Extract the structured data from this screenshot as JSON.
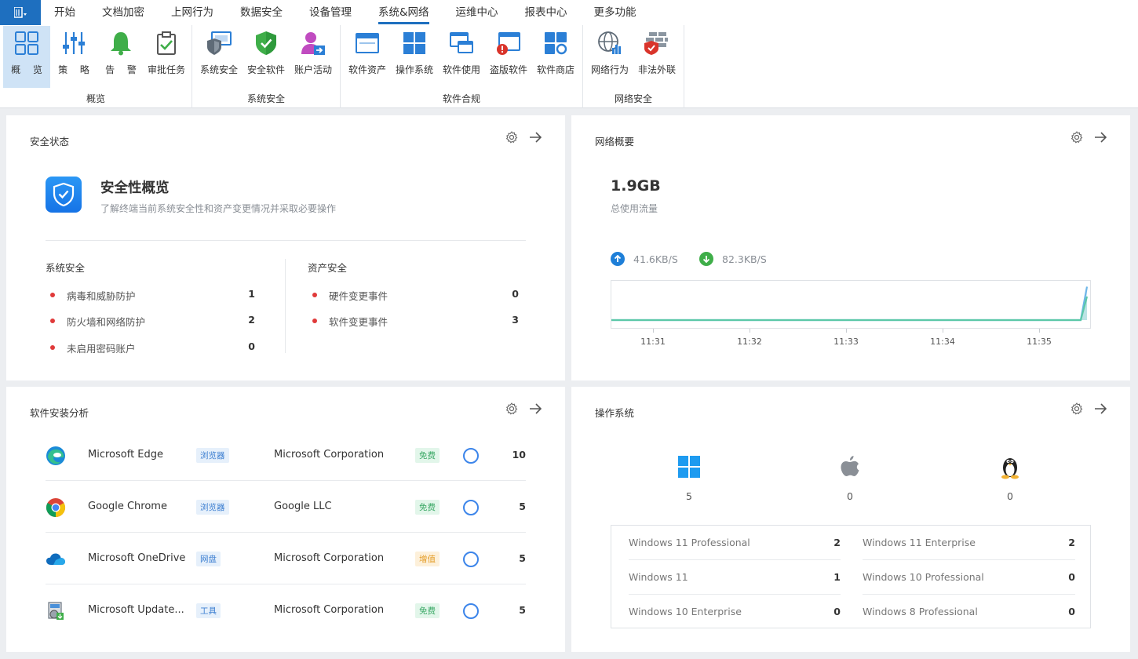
{
  "menu": {
    "tabs": [
      {
        "label": "开始"
      },
      {
        "label": "文档加密"
      },
      {
        "label": "上网行为"
      },
      {
        "label": "数据安全"
      },
      {
        "label": "设备管理"
      },
      {
        "label": "系统&网络",
        "active": true
      },
      {
        "label": "运维中心"
      },
      {
        "label": "报表中心"
      },
      {
        "label": "更多功能"
      }
    ]
  },
  "ribbon": {
    "groups": {
      "overview": "概览",
      "system_security": "系统安全",
      "software_compliance": "软件合规",
      "network_security": "网络安全"
    },
    "buttons": {
      "overview": "概 览",
      "policy": "策 略",
      "alert": "告 警",
      "approval": "审批任务",
      "sys_security": "系统安全",
      "security_software": "安全软件",
      "account_activity": "账户活动",
      "software_assets": "软件资产",
      "operating_system": "操作系统",
      "software_usage": "软件使用",
      "pirated_software": "盗版软件",
      "software_store": "软件商店",
      "network_behavior": "网络行为",
      "illegal_outreach": "非法外联"
    }
  },
  "security_card": {
    "title": "安全状态",
    "heading": "安全性概览",
    "subtitle": "了解终端当前系统安全性和资产变更情况并采取必要操作",
    "system": {
      "title": "系统安全",
      "items": [
        {
          "label": "病毒和威胁防护",
          "count": "1"
        },
        {
          "label": "防火墙和网络防护",
          "count": "2"
        },
        {
          "label": "未启用密码账户",
          "count": "0"
        }
      ]
    },
    "assets": {
      "title": "资产安全",
      "items": [
        {
          "label": "硬件变更事件",
          "count": "0"
        },
        {
          "label": "软件变更事件",
          "count": "3"
        }
      ]
    }
  },
  "network_card": {
    "title": "网络概要",
    "total": "1.9GB",
    "total_label": "总使用流量",
    "upload": "41.6KB/S",
    "download": "82.3KB/S",
    "ticks": [
      "11:31",
      "11:32",
      "11:33",
      "11:34",
      "11:35"
    ]
  },
  "chart_data": {
    "type": "area",
    "x": [
      "11:31",
      "11:32",
      "11:33",
      "11:34",
      "11:35"
    ],
    "series": [
      {
        "values": [
          0,
          0,
          0,
          0,
          0,
          1
        ]
      },
      {
        "values": [
          0,
          0,
          0,
          0,
          0,
          0.8
        ]
      }
    ],
    "grid": false,
    "colors": [
      "#6fb6e8",
      "#5cc8a8"
    ]
  },
  "software_card": {
    "title": "软件安装分析",
    "rows": [
      {
        "name": "Microsoft Edge",
        "tag": "浏览器",
        "vendor": "Microsoft Corporation",
        "license": "免费",
        "count": "10",
        "icon": "edge-icon"
      },
      {
        "name": "Google Chrome",
        "tag": "浏览器",
        "vendor": "Google LLC",
        "license": "免费",
        "count": "5",
        "icon": "chrome-icon"
      },
      {
        "name": "Microsoft OneDrive",
        "tag": "网盘",
        "vendor": "Microsoft Corporation",
        "license": "增值",
        "count": "5",
        "icon": "onedrive-icon"
      },
      {
        "name": "Microsoft Update...",
        "tag": "工具",
        "vendor": "Microsoft Corporation",
        "license": "免费",
        "count": "5",
        "icon": "installer-icon"
      }
    ]
  },
  "os_card": {
    "title": "操作系统",
    "counts": {
      "windows": "5",
      "mac": "0",
      "linux": "0"
    },
    "versions": [
      {
        "name": "Windows 11 Professional",
        "count": "2"
      },
      {
        "name": "Windows 11 Enterprise",
        "count": "2"
      },
      {
        "name": "Windows 11",
        "count": "1"
      },
      {
        "name": "Windows 10 Professional",
        "count": "0"
      },
      {
        "name": "Windows 10 Enterprise",
        "count": "0"
      },
      {
        "name": "Windows 8 Professional",
        "count": "0"
      }
    ]
  },
  "colors": {
    "accent": "#1e6fbf",
    "alert_dot": "#e03a3a",
    "free": "#3aa865",
    "paid": "#e39a22"
  }
}
